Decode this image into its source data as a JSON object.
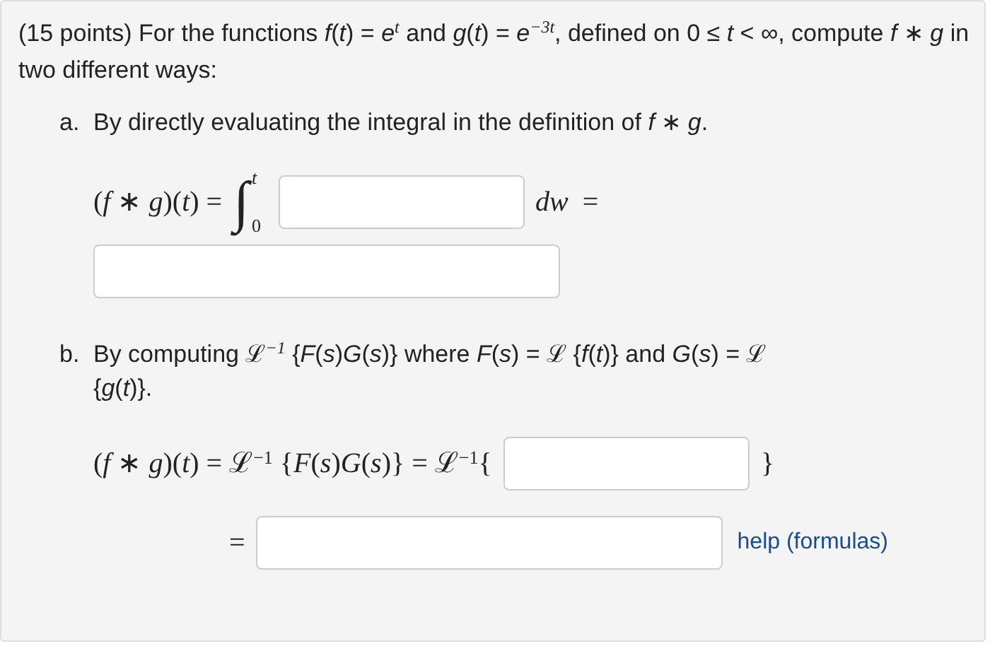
{
  "intro": "(15 points) For the functions *f*(*t*) = *e*$^{t}$ and *g*(*t*) = *e*$^{−3t}$, defined on 0 ≤ *t* < ∞, compute *f* ∗ *g* in two different ways:",
  "parts": [
    {
      "marker": "a.",
      "text": "By directly evaluating the integral in the definition of *f* ∗ *g*.",
      "rows": [
        [
          {
            "kind": "math",
            "text": "(*f* ∗ *g*)(*t*) ="
          },
          {
            "kind": "integral",
            "sign": "∫",
            "upper": "t",
            "lower": "0"
          },
          {
            "kind": "field"
          },
          {
            "kind": "math",
            "text": "*dw*  ="
          }
        ],
        [
          {
            "kind": "wide_field"
          }
        ]
      ]
    },
    {
      "marker": "b.",
      "text": "By computing ℒ$^{−1}$ {*F*(*s*)*G*(*s*)} where *F*(*s*) = ℒ {*f*(*t*)} and *G*(*s*) = ℒ {*g*(*t*)}.",
      "rows": [
        [
          {
            "kind": "math",
            "text": "(*f* ∗ *g*)(*t*) = ℒ$^{−1}$ {*F*(*s*)*G*(*s*)} = ℒ$^{−1}${"
          },
          {
            "kind": "field"
          },
          {
            "kind": "math",
            "text": "}"
          }
        ],
        [
          {
            "kind": "math",
            "text": "="
          },
          {
            "kind": "wide_field"
          },
          {
            "kind": "link",
            "text": "help (formulas)"
          }
        ]
      ]
    }
  ]
}
